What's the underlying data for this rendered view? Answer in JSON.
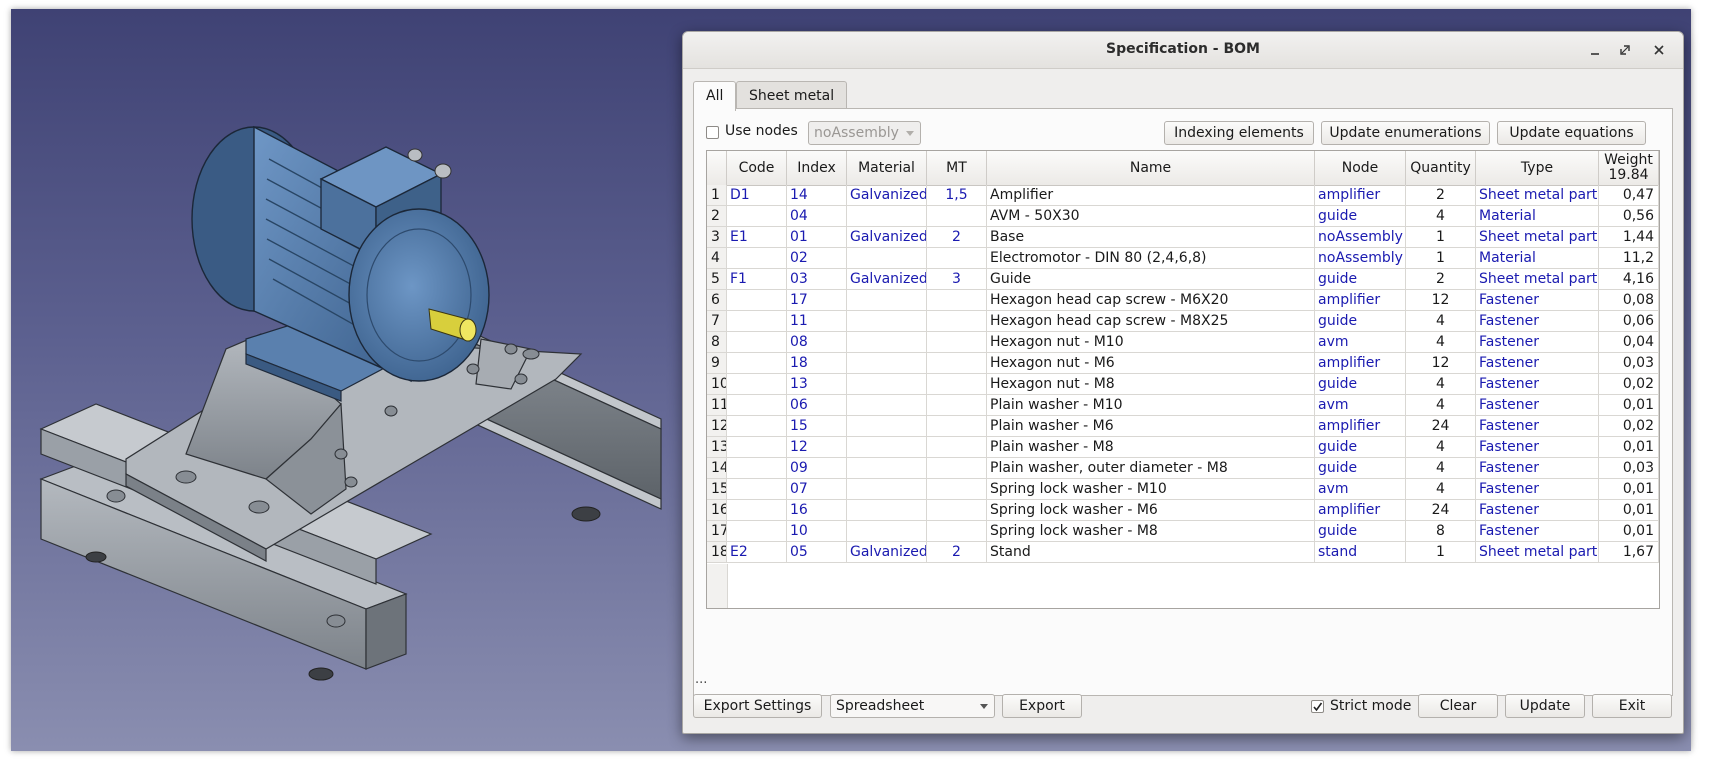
{
  "dialog": {
    "title": "Specification - BOM",
    "tabs": [
      {
        "label": "All"
      },
      {
        "label": "Sheet metal"
      }
    ],
    "use_nodes_label": "Use nodes",
    "use_nodes_checked": false,
    "assembly_combo_value": "noAssembly",
    "buttons": {
      "indexing": "Indexing elements",
      "enumerations": "Update enumerations",
      "equations": "Update equations",
      "export_settings": "Export Settings",
      "export": "Export",
      "clear": "Clear",
      "update": "Update",
      "exit": "Exit"
    },
    "export_format": "Spreadsheet",
    "strict_mode_label": "Strict mode",
    "strict_mode_checked": true,
    "status_text": "..."
  },
  "table": {
    "columns": [
      "Code",
      "Index",
      "Material",
      "MT",
      "Name",
      "Node",
      "Quantity",
      "Type"
    ],
    "weight_header": "Weight",
    "weight_total": "19.84",
    "rows": [
      {
        "n": "1",
        "code": "D1",
        "index": "14",
        "material": "Galvanized",
        "mt": "1,5",
        "name": "Amplifier",
        "node": "amplifier",
        "qty": "2",
        "type": "Sheet metal part",
        "weight": "0,47"
      },
      {
        "n": "2",
        "code": "",
        "index": "04",
        "material": "",
        "mt": "",
        "name": "AVM - 50X30",
        "node": "guide",
        "qty": "4",
        "type": "Material",
        "weight": "0,56"
      },
      {
        "n": "3",
        "code": "E1",
        "index": "01",
        "material": "Galvanized",
        "mt": "2",
        "name": "Base",
        "node": "noAssembly",
        "qty": "1",
        "type": "Sheet metal part",
        "weight": "1,44"
      },
      {
        "n": "4",
        "code": "",
        "index": "02",
        "material": "",
        "mt": "",
        "name": "Electromotor - DIN 80 (2,4,6,8)",
        "node": "noAssembly",
        "qty": "1",
        "type": "Material",
        "weight": "11,2"
      },
      {
        "n": "5",
        "code": "F1",
        "index": "03",
        "material": "Galvanized",
        "mt": "3",
        "name": "Guide",
        "node": "guide",
        "qty": "2",
        "type": "Sheet metal part",
        "weight": "4,16"
      },
      {
        "n": "6",
        "code": "",
        "index": "17",
        "material": "",
        "mt": "",
        "name": "Hexagon head cap screw - M6X20",
        "node": "amplifier",
        "qty": "12",
        "type": "Fastener",
        "weight": "0,08"
      },
      {
        "n": "7",
        "code": "",
        "index": "11",
        "material": "",
        "mt": "",
        "name": "Hexagon head cap screw - M8X25",
        "node": "guide",
        "qty": "4",
        "type": "Fastener",
        "weight": "0,06"
      },
      {
        "n": "8",
        "code": "",
        "index": "08",
        "material": "",
        "mt": "",
        "name": "Hexagon nut - M10",
        "node": "avm",
        "qty": "4",
        "type": "Fastener",
        "weight": "0,04"
      },
      {
        "n": "9",
        "code": "",
        "index": "18",
        "material": "",
        "mt": "",
        "name": "Hexagon nut - M6",
        "node": "amplifier",
        "qty": "12",
        "type": "Fastener",
        "weight": "0,03"
      },
      {
        "n": "10",
        "code": "",
        "index": "13",
        "material": "",
        "mt": "",
        "name": "Hexagon nut - M8",
        "node": "guide",
        "qty": "4",
        "type": "Fastener",
        "weight": "0,02"
      },
      {
        "n": "11",
        "code": "",
        "index": "06",
        "material": "",
        "mt": "",
        "name": "Plain washer - M10",
        "node": "avm",
        "qty": "4",
        "type": "Fastener",
        "weight": "0,01"
      },
      {
        "n": "12",
        "code": "",
        "index": "15",
        "material": "",
        "mt": "",
        "name": "Plain washer - M6",
        "node": "amplifier",
        "qty": "24",
        "type": "Fastener",
        "weight": "0,02"
      },
      {
        "n": "13",
        "code": "",
        "index": "12",
        "material": "",
        "mt": "",
        "name": "Plain washer - M8",
        "node": "guide",
        "qty": "4",
        "type": "Fastener",
        "weight": "0,01"
      },
      {
        "n": "14",
        "code": "",
        "index": "09",
        "material": "",
        "mt": "",
        "name": "Plain washer, outer diameter - M8",
        "node": "guide",
        "qty": "4",
        "type": "Fastener",
        "weight": "0,03"
      },
      {
        "n": "15",
        "code": "",
        "index": "07",
        "material": "",
        "mt": "",
        "name": "Spring lock washer - M10",
        "node": "avm",
        "qty": "4",
        "type": "Fastener",
        "weight": "0,01"
      },
      {
        "n": "16",
        "code": "",
        "index": "16",
        "material": "",
        "mt": "",
        "name": "Spring lock washer - M6",
        "node": "amplifier",
        "qty": "24",
        "type": "Fastener",
        "weight": "0,01"
      },
      {
        "n": "17",
        "code": "",
        "index": "10",
        "material": "",
        "mt": "",
        "name": "Spring lock washer - M8",
        "node": "guide",
        "qty": "8",
        "type": "Fastener",
        "weight": "0,01"
      },
      {
        "n": "18",
        "code": "E2",
        "index": "05",
        "material": "Galvanized",
        "mt": "2",
        "name": "Stand",
        "node": "stand",
        "qty": "1",
        "type": "Sheet metal part",
        "weight": "1,67"
      }
    ]
  },
  "colors": {
    "link_blue": "#1a1ab0",
    "motor_blue": "#4f78a8",
    "steel_gray": "#8f959c"
  }
}
